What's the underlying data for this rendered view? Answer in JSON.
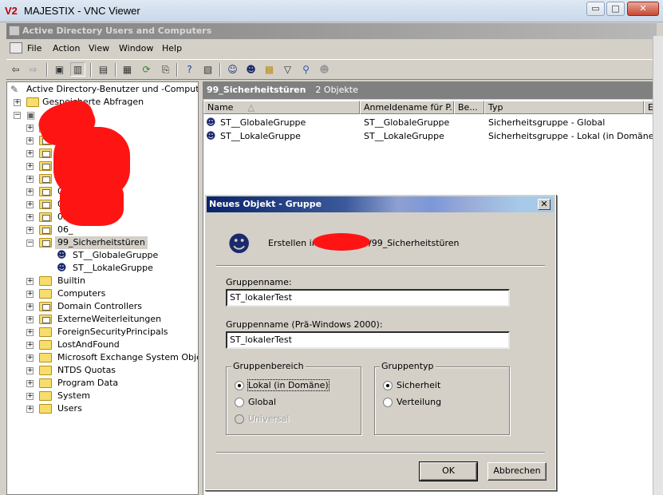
{
  "vnc": {
    "title": "MAJESTIX - VNC Viewer",
    "logo": "V2",
    "btn_min": "▭",
    "btn_max": "□",
    "btn_close": "✕"
  },
  "mmc": {
    "title": "Active Directory Users and Computers",
    "menu": [
      "File",
      "Action",
      "View",
      "Window",
      "Help"
    ]
  },
  "toolbar": {
    "icons": [
      "back-icon",
      "forward-icon",
      "up-folder-icon",
      "show-tree-icon",
      "delete-icon",
      "properties-icon",
      "refresh-icon",
      "export-icon",
      "help-icon",
      "console-icon",
      "new-user-icon",
      "new-group-icon",
      "new-ou-icon",
      "filter-icon",
      "find-icon",
      "add-group-icon"
    ]
  },
  "tree": {
    "root": "Active Directory-Benutzer und -Computer [m",
    "saved_queries": "Gespeicherte Abfragen",
    "redacted_ous": [
      {
        "visible_text": ""
      },
      {
        "visible_text": ""
      },
      {
        "visible_text": ""
      },
      {
        "visible_text": "0"
      },
      {
        "visible_text": "0"
      },
      {
        "visible_text": "03"
      },
      {
        "visible_text": "04"
      },
      {
        "visible_text": "05"
      },
      {
        "visible_text": "06_"
      }
    ],
    "selected_ou": "99_Sicherheitstüren",
    "children": [
      "ST__GlobaleGruppe",
      "ST__LokaleGruppe"
    ],
    "containers": [
      "Builtin",
      "Computers",
      "Domain Controllers",
      "ExterneWeiterleitungen",
      "ForeignSecurityPrincipals",
      "LostAndFound",
      "Microsoft Exchange System Objects",
      "NTDS Quotas",
      "Program Data",
      "System",
      "Users"
    ]
  },
  "list": {
    "header_title": "99_Sicherheitstüren",
    "header_count": "2 Objekte",
    "columns": [
      "Name",
      "Anmeldename für P...",
      "Be...",
      "Typ",
      "E"
    ],
    "rows": [
      {
        "name": "ST__GlobaleGruppe",
        "login": "ST__GlobaleGruppe",
        "desc": "",
        "type": "Sicherheitsgruppe - Global"
      },
      {
        "name": "ST__LokaleGruppe",
        "login": "ST__LokaleGruppe",
        "desc": "",
        "type": "Sicherheitsgruppe - Lokal (in Domäne)"
      }
    ]
  },
  "dialog": {
    "title": "Neues Objekt - Gruppe",
    "close": "✕",
    "create_in_prefix": "Erstellen in:",
    "create_in_suffix": "/99_Sicherheitstüren",
    "group_name_label": "Gruppenname:",
    "group_name_value": "ST_lokalerTest",
    "group_name_pre2000_label": "Gruppenname (Prä-Windows 2000):",
    "group_name_pre2000_value": "ST_lokalerTest",
    "scope": {
      "title": "Gruppenbereich",
      "options": [
        "Lokal (in Domäne)",
        "Global",
        "Universal"
      ],
      "selected": "Lokal (in Domäne)",
      "disabled": [
        "Universal"
      ]
    },
    "type": {
      "title": "Gruppentyp",
      "options": [
        "Sicherheit",
        "Verteilung"
      ],
      "selected": "Sicherheit"
    },
    "ok": "OK",
    "cancel": "Abbrechen"
  },
  "colors": {
    "redaction": "#ff1414",
    "dialog_title_start": "#0a246a",
    "face": "#d4d0c8"
  }
}
